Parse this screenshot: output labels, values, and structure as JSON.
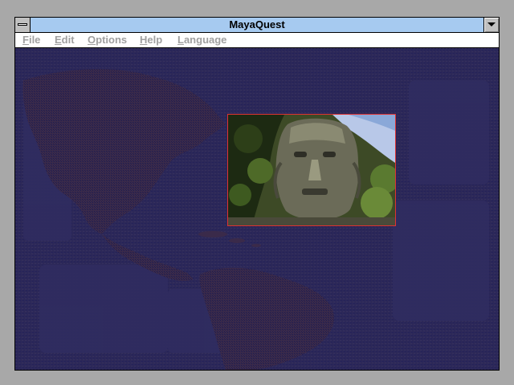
{
  "window": {
    "title": "MayaQuest"
  },
  "menu": {
    "items": [
      {
        "label_first": "F",
        "label_rest": "ile"
      },
      {
        "label_first": "E",
        "label_rest": "dit"
      },
      {
        "label_first": "O",
        "label_rest": "ptions"
      },
      {
        "label_first": "H",
        "label_rest": "elp"
      },
      {
        "label_first": "L",
        "label_rest": "anguage"
      }
    ]
  },
  "icons": {
    "system_menu": "system-menu-icon",
    "minimize": "minimize-icon"
  },
  "colors": {
    "desktop": "#a8a8a8",
    "titlebar": "#a6caf0",
    "client_background": "#25235a",
    "menu_disabled_text": "#a0a0a0",
    "photo_border": "#d33333"
  }
}
